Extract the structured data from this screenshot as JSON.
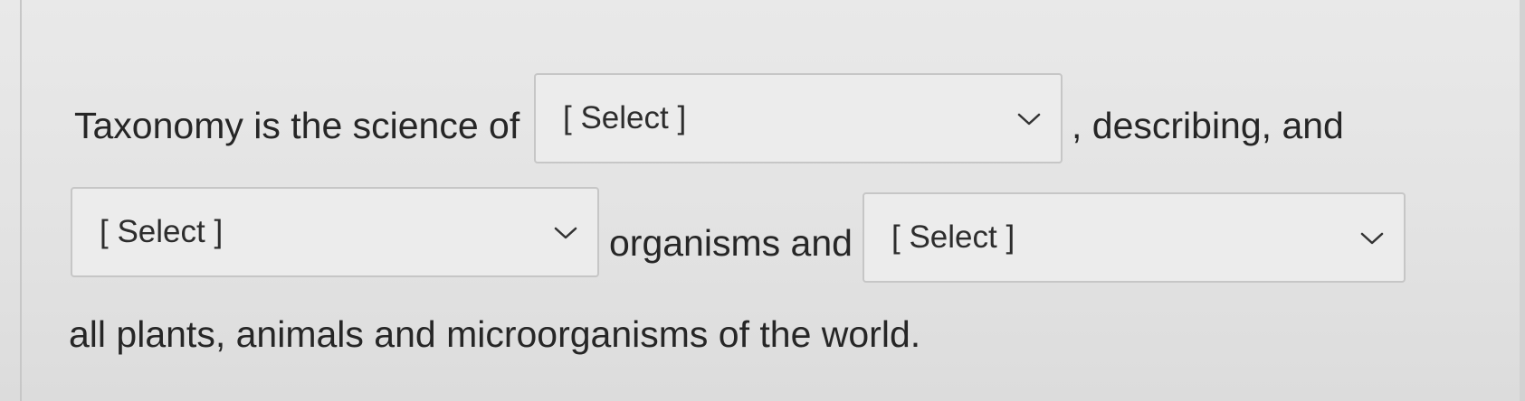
{
  "question": {
    "line1_start": "Taxonomy is the science of",
    "line1_end": ", describing, and",
    "line2_middle": "organisms and",
    "line3": "all plants, animals and microorganisms of the world."
  },
  "dropdowns": [
    {
      "selected": "[ Select ]",
      "icon": "chevron-down-icon"
    },
    {
      "selected": "[ Select ]",
      "icon": "chevron-down-icon"
    },
    {
      "selected": "[ Select ]",
      "icon": "chevron-down-icon"
    }
  ],
  "colors": {
    "text": "#262626",
    "dropdown_border": "#c6c6c6",
    "background": "#e6e6e6"
  }
}
